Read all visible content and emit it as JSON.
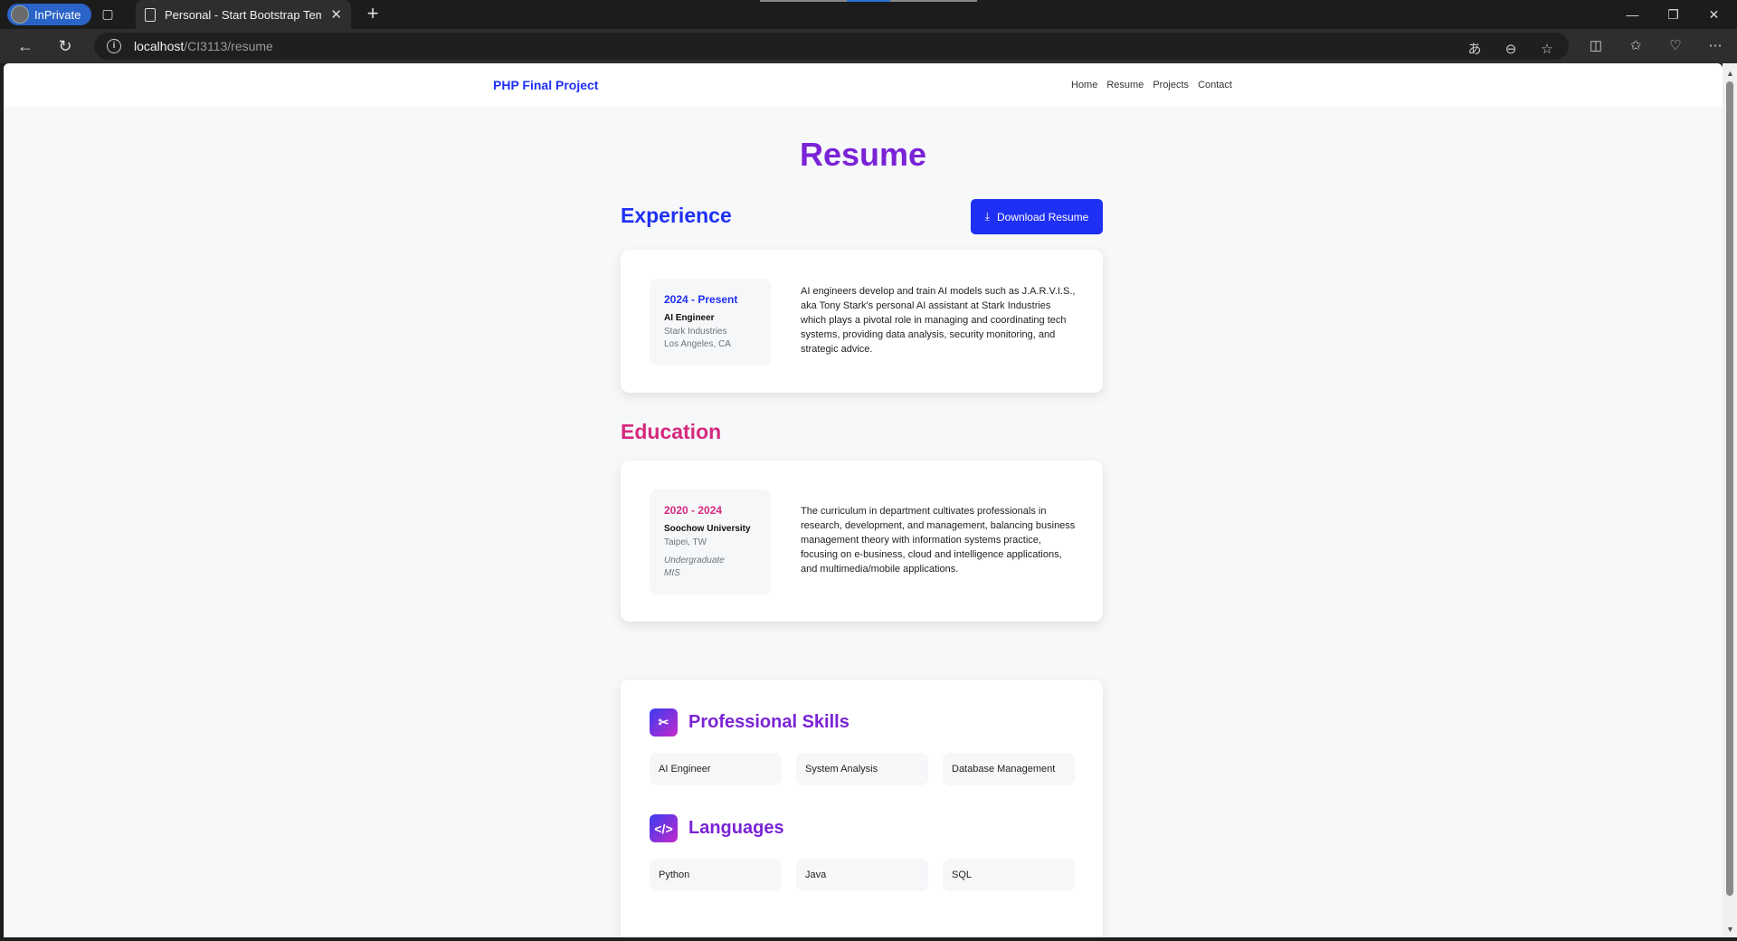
{
  "browser": {
    "inprivate_label": "InPrivate",
    "tab_title": "Personal - Start Bootstrap Templ",
    "url_host": "localhost",
    "url_path": "/CI3113/resume"
  },
  "navbar": {
    "brand": "PHP Final Project",
    "links": [
      "Home",
      "Resume",
      "Projects",
      "Contact"
    ]
  },
  "page": {
    "title": "Resume",
    "download_label": "Download Resume"
  },
  "experience": {
    "heading": "Experience",
    "item": {
      "years": "2024 - Present",
      "role": "AI Engineer",
      "org": "Stark Industries",
      "location": "Los Angeles, CA",
      "description": "AI engineers develop and train AI models such as J.A.R.V.I.S., aka Tony Stark's personal AI assistant at Stark Industries which plays a pivotal role in managing and coordinating tech systems, providing data analysis, security monitoring, and strategic advice."
    }
  },
  "education": {
    "heading": "Education",
    "item": {
      "years": "2020 - 2024",
      "school": "Soochow University",
      "location": "Taipei, TW",
      "degree": "Undergraduate",
      "major": "MIS",
      "description": "The curriculum in department cultivates professionals in research, development, and management, balancing business management theory with information systems practice, focusing on e-business, cloud and intelligence applications, and multimedia/mobile applications."
    }
  },
  "skills": {
    "professional_heading": "Professional Skills",
    "professional": [
      "AI Engineer",
      "System Analysis",
      "Database Management"
    ],
    "languages_heading": "Languages",
    "languages": [
      "Python",
      "Java",
      "SQL"
    ]
  },
  "colors": {
    "primary": "#1e30f3",
    "pink": "#d6297f",
    "purple": "#7a23d6"
  }
}
